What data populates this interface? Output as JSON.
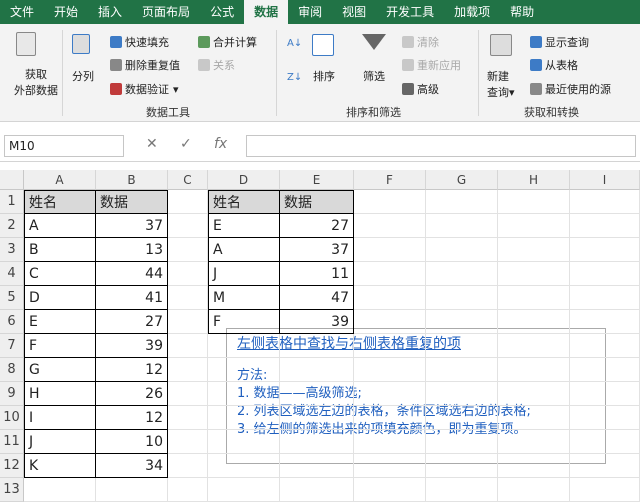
{
  "menu": {
    "tabs": [
      {
        "label": "文件",
        "active": false
      },
      {
        "label": "开始",
        "active": false
      },
      {
        "label": "插入",
        "active": false
      },
      {
        "label": "页面布局",
        "active": false
      },
      {
        "label": "公式",
        "active": false
      },
      {
        "label": "数据",
        "active": true
      },
      {
        "label": "审阅",
        "active": false
      },
      {
        "label": "视图",
        "active": false
      },
      {
        "label": "开发工具",
        "active": false
      },
      {
        "label": "加载项",
        "active": false
      },
      {
        "label": "帮助",
        "active": false
      }
    ]
  },
  "ribbon": {
    "get_external_line1": "获取",
    "get_external_line2": "外部数据",
    "split": "分列",
    "flash_fill": "快速填充",
    "remove_dup": "删除重复值",
    "validate": "数据验证",
    "merge_calc": "合并计算",
    "relation": "关系",
    "group_data_tools": "数据工具",
    "sort": "排序",
    "filter": "筛选",
    "clear": "清除",
    "reapply": "重新应用",
    "advanced": "高级",
    "group_sort_filter": "排序和筛选",
    "new_query_line1": "新建",
    "new_query_line2": "查询",
    "show_query": "显示查询",
    "from_table": "从表格",
    "recent_sources": "最近使用的源",
    "group_get_transform": "获取和转换",
    "colors": {
      "menu_bg": "#217346",
      "ribbon_bg": "#f3f3f3",
      "note_text": "#1f5fbf"
    }
  },
  "formula_bar": {
    "name_box": "M10",
    "cancel_icon": "✕",
    "confirm_icon": "✓",
    "fx_icon": "fx",
    "content": ""
  },
  "sheet": {
    "columns": [
      "A",
      "B",
      "C",
      "D",
      "E",
      "F",
      "G",
      "H",
      "I"
    ],
    "rows": [
      "1",
      "2",
      "3",
      "4",
      "5",
      "6",
      "7",
      "8",
      "9",
      "10",
      "11",
      "12",
      "13"
    ],
    "left_table": {
      "header": [
        "姓名",
        "数据"
      ],
      "rows": [
        [
          "A",
          "37"
        ],
        [
          "B",
          "13"
        ],
        [
          "C",
          "44"
        ],
        [
          "D",
          "41"
        ],
        [
          "E",
          "27"
        ],
        [
          "F",
          "39"
        ],
        [
          "G",
          "12"
        ],
        [
          "H",
          "26"
        ],
        [
          "I",
          "12"
        ],
        [
          "J",
          "10"
        ],
        [
          "K",
          "34"
        ]
      ]
    },
    "right_table": {
      "header": [
        "姓名",
        "数据"
      ],
      "rows": [
        [
          "E",
          "27"
        ],
        [
          "A",
          "37"
        ],
        [
          "J",
          "11"
        ],
        [
          "M",
          "47"
        ],
        [
          "F",
          "39"
        ]
      ]
    }
  },
  "note": {
    "title": "左侧表格中查找与右侧表格重复的项",
    "heading": "方法:",
    "step1": "1. 数据——高级筛选;",
    "step2": "2. 列表区域选左边的表格，条件区域选右边的表格;",
    "step3": "3. 给左侧的筛选出来的项填充颜色，即为重复项。"
  }
}
